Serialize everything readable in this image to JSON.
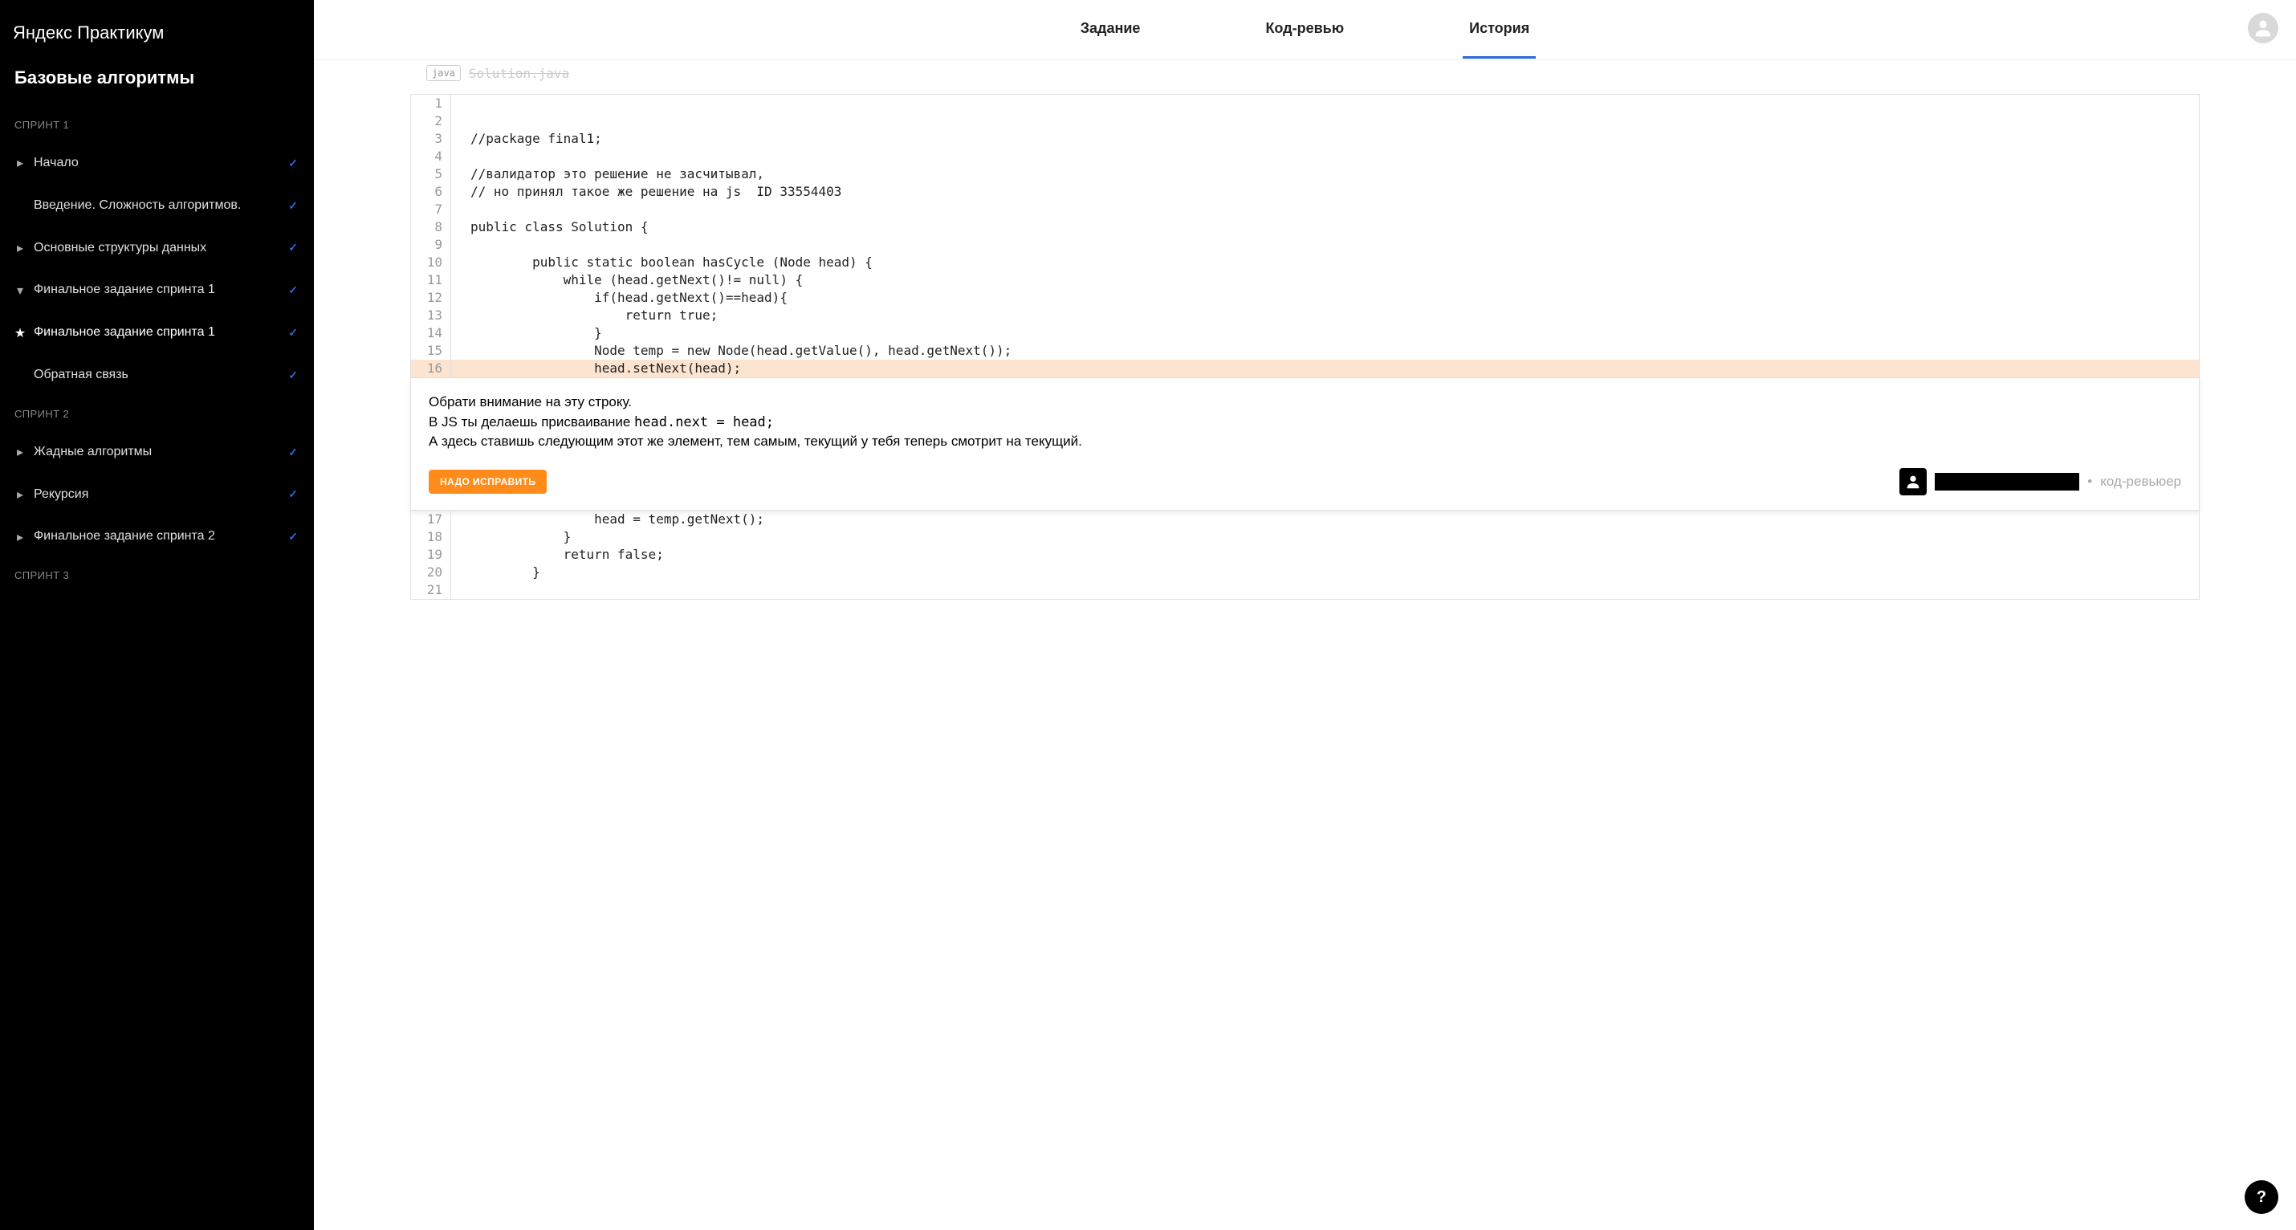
{
  "logo": {
    "bold": "Яндекс",
    "light": "Практикум"
  },
  "course_title": "Базовые алгоритмы",
  "sprints": [
    {
      "label": "СПРИНТ 1",
      "items": [
        {
          "icon": "caret",
          "label": "Начало",
          "checked": true
        },
        {
          "icon": "none",
          "label": "Введение. Сложность алгоритмов.",
          "checked": true
        },
        {
          "icon": "caret",
          "label": "Основные структуры данных",
          "checked": true
        },
        {
          "icon": "caret-down",
          "label": "Финальное задание спринта 1",
          "checked": true
        },
        {
          "icon": "star",
          "label": "Финальное задание спринта 1",
          "checked": true,
          "active": true
        },
        {
          "icon": "none",
          "label": "Обратная связь",
          "checked": true
        }
      ]
    },
    {
      "label": "СПРИНТ 2",
      "items": [
        {
          "icon": "caret",
          "label": "Жадные алгоритмы",
          "checked": true
        },
        {
          "icon": "caret",
          "label": "Рекурсия",
          "checked": true
        },
        {
          "icon": "caret",
          "label": "Финальное задание спринта 2",
          "checked": true
        }
      ]
    },
    {
      "label": "СПРИНТ 3",
      "items": []
    }
  ],
  "tabs": [
    {
      "label": "Задание",
      "active": false
    },
    {
      "label": "Код-ревью",
      "active": false
    },
    {
      "label": "История",
      "active": true
    }
  ],
  "file": {
    "lang": "java",
    "name": "Solution.java"
  },
  "code_top": [
    {
      "n": 1,
      "t": ""
    },
    {
      "n": 2,
      "t": ""
    },
    {
      "n": 3,
      "t": "//package final1;"
    },
    {
      "n": 4,
      "t": ""
    },
    {
      "n": 5,
      "t": "//валидатор это решение не засчитывал,"
    },
    {
      "n": 6,
      "t": "// но принял такое же решение на js  ID 33554403"
    },
    {
      "n": 7,
      "t": ""
    },
    {
      "n": 8,
      "t": "public class Solution {"
    },
    {
      "n": 9,
      "t": ""
    },
    {
      "n": 10,
      "t": "        public static boolean hasCycle (Node head) {"
    },
    {
      "n": 11,
      "t": "            while (head.getNext()!= null) {"
    },
    {
      "n": 12,
      "t": "                if(head.getNext()==head){"
    },
    {
      "n": 13,
      "t": "                    return true;"
    },
    {
      "n": 14,
      "t": "                }"
    },
    {
      "n": 15,
      "t": "                Node temp = new Node(head.getValue(), head.getNext());"
    },
    {
      "n": 16,
      "t": "                head.setNext(head);",
      "highlight": true
    }
  ],
  "comment": {
    "l1": "Обрати внимание на эту строку.",
    "l2a": "В JS ты делаешь присваивание ",
    "l2b": "head.next = head;",
    "l3": "А здесь ставишь следующим этот же элемент, тем самым, текущий у тебя теперь смотрит на текущий.",
    "button": "НАДО ИСПРАВИТЬ",
    "role": "код-ревьюер"
  },
  "code_bottom": [
    {
      "n": 17,
      "t": "                head = temp.getNext();"
    },
    {
      "n": 18,
      "t": "            }"
    },
    {
      "n": 19,
      "t": "            return false;"
    },
    {
      "n": 20,
      "t": "        }"
    },
    {
      "n": 21,
      "t": ""
    }
  ],
  "help": "?"
}
